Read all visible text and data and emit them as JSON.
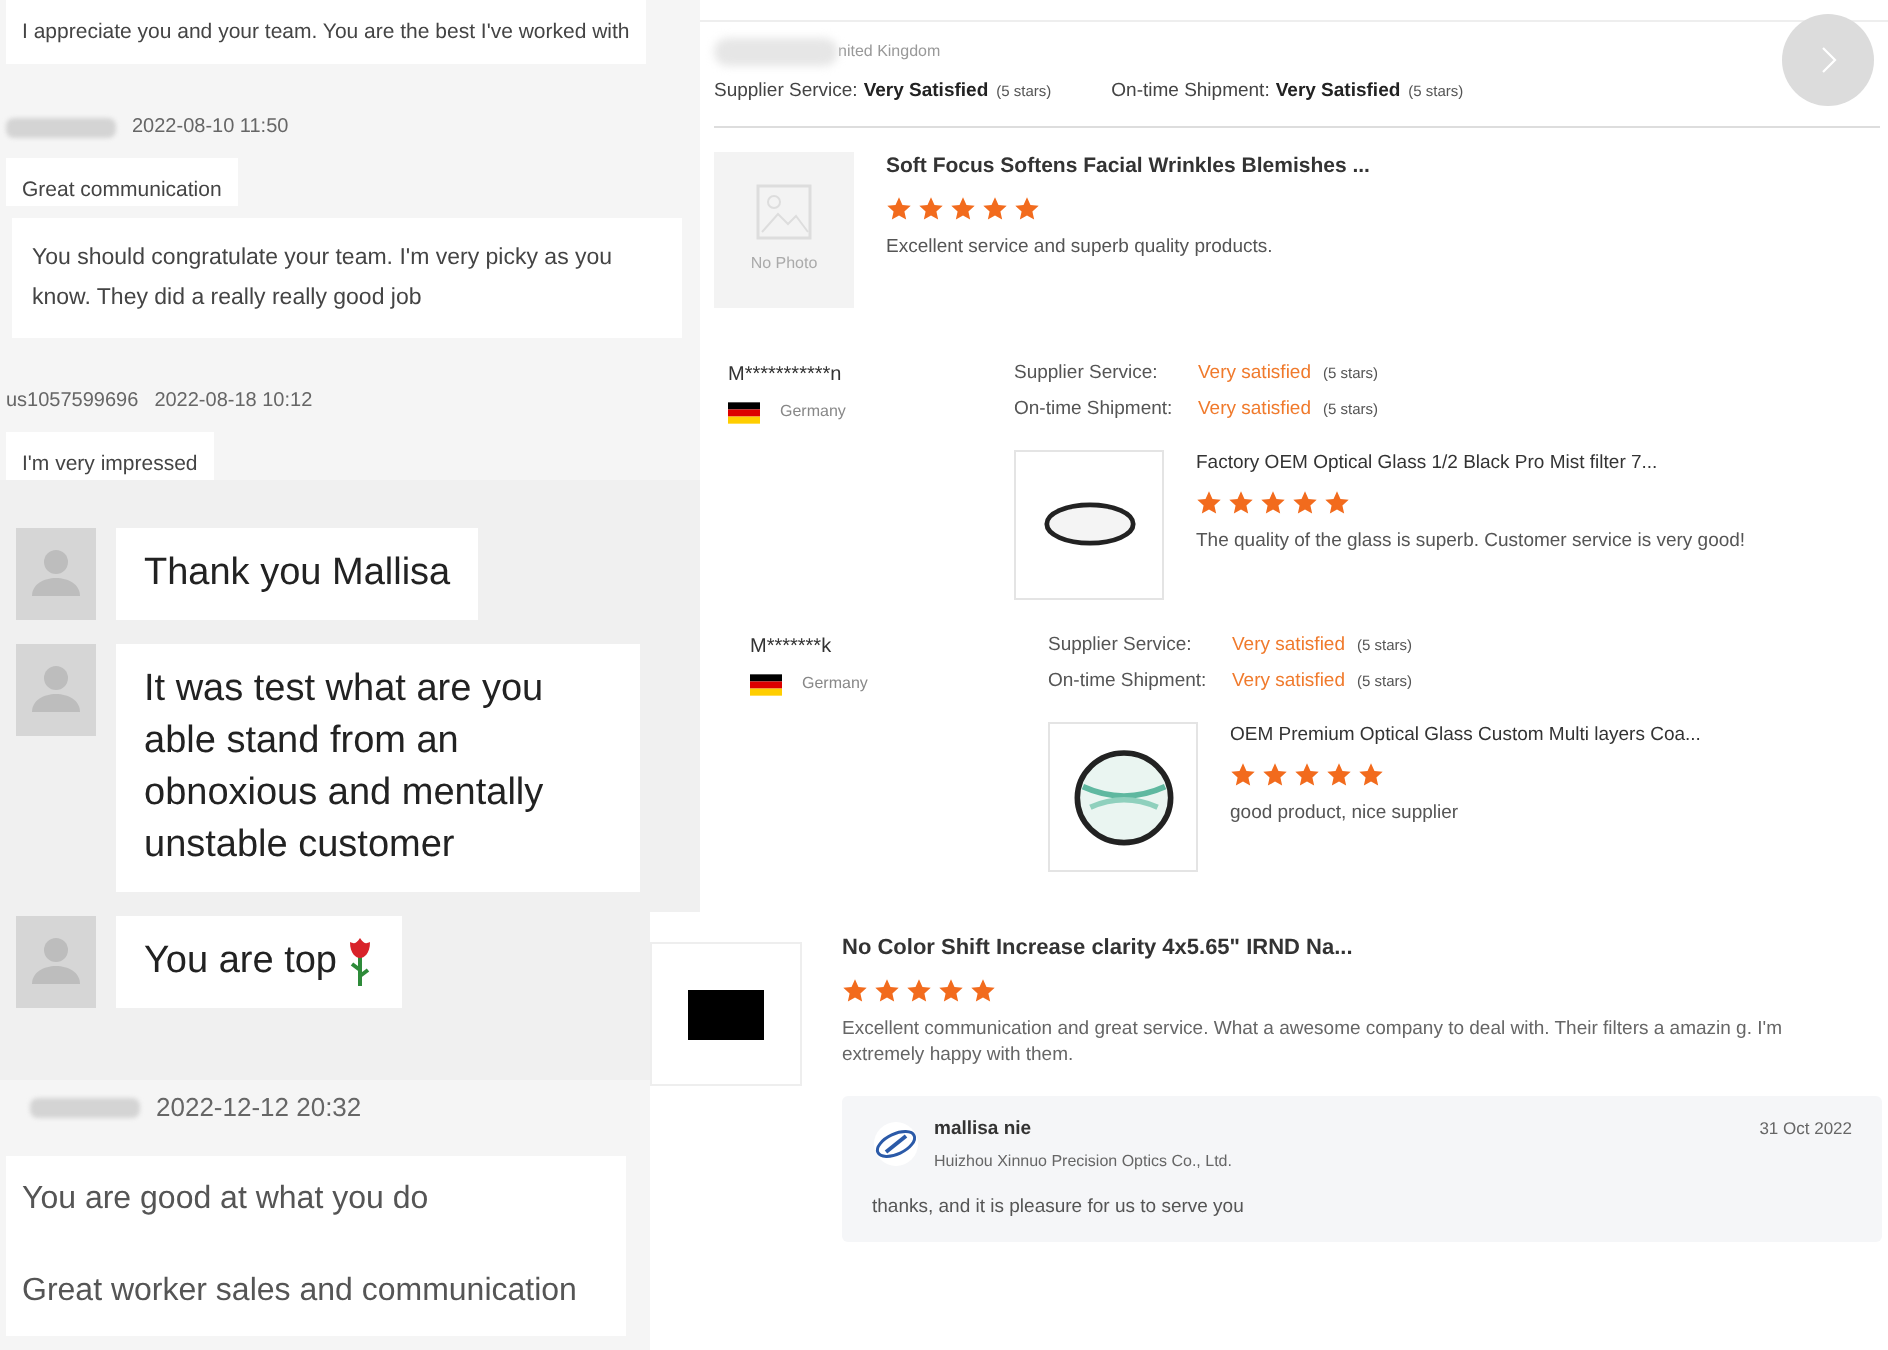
{
  "chat_panels": [
    {
      "kind": "plain",
      "items": [
        {
          "kind": "bubble",
          "text": "I appreciate you and your team. You are the best I've worked with"
        },
        {
          "kind": "meta",
          "time": "2022-08-10 11:50"
        },
        {
          "kind": "bubble",
          "text": "Great communication"
        }
      ]
    },
    {
      "kind": "plain",
      "items": [
        {
          "kind": "bubble",
          "text": "You should congratulate your team. I'm very picky as you know. They did a really really good job"
        },
        {
          "kind": "meta",
          "sender": "us1057599696",
          "time": "2022-08-18 10:12"
        },
        {
          "kind": "bubble",
          "text": "I'm very impressed"
        }
      ]
    },
    {
      "kind": "large",
      "items": [
        {
          "kind": "bubble",
          "text": "Thank you Mallisa"
        },
        {
          "kind": "bubble",
          "text": "It was test what are you able stand from an obnoxious and mentally unstable customer"
        },
        {
          "kind": "rosebubble",
          "text": "You are top"
        }
      ]
    },
    {
      "kind": "plain",
      "items": [
        {
          "kind": "meta",
          "time": "2022-12-12 20:32"
        },
        {
          "kind": "bubble",
          "text": "You are good at what you do",
          "text_2": "Great worker sales and communication"
        }
      ]
    }
  ],
  "reviews": [
    {
      "kind": "summary",
      "country": "nited Kingdom",
      "supplier_label": "Supplier Service:",
      "supplier_value": "Very Satisfied",
      "supplier_stars": "(5 stars)",
      "shipment_label": "On-time Shipment:",
      "shipment_value": "Very Satisfied",
      "shipment_stars": "(5 stars)",
      "product": {
        "kind": "none",
        "image_text": "No Photo",
        "title": "Soft Focus Softens Facial Wrinkles Blemishes ...",
        "stars": 5,
        "text": "Excellent service and superb quality products."
      }
    },
    {
      "kind": "detail",
      "name": "M***********n",
      "country": "Germany",
      "supplier_label": "Supplier Service:",
      "supplier_value": "Very satisfied",
      "supplier_stars": "(5 stars)",
      "shipment_label": "On-time Shipment:",
      "shipment_value": "Very satisfied",
      "shipment_stars": "(5 stars)",
      "product": {
        "kind": "ring",
        "title": "Factory OEM Optical Glass 1/2 Black Pro Mist filter 7...",
        "stars": 5,
        "text": "The quality of the glass is superb. Customer service is very good!"
      }
    },
    {
      "kind": "detail",
      "name": "M*******k",
      "country": "Germany",
      "supplier_label": "Supplier Service:",
      "supplier_value": "Very satisfied",
      "supplier_stars": "(5 stars)",
      "shipment_label": "On-time Shipment:",
      "shipment_value": "Very satisfied",
      "shipment_stars": "(5 stars)",
      "product": {
        "kind": "glass",
        "title": "OEM Premium Optical Glass Custom Multi layers Coa...",
        "stars": 5,
        "text": "good product, nice supplier"
      }
    },
    {
      "kind": "replied",
      "product": {
        "kind": "block",
        "title": "No Color Shift Increase clarity 4x5.65\" IRND Na...",
        "stars": 5,
        "text": "Excellent communication and great service. What a awesome company to deal with. Their filters a amazin g. I'm extremely happy with them."
      },
      "reply": {
        "name": "mallisa nie",
        "company": "Huizhou Xinnuo Precision Optics Co., Ltd.",
        "date": "31 Oct 2022",
        "text": "thanks,  and it is pleasure for us to serve you"
      }
    }
  ]
}
